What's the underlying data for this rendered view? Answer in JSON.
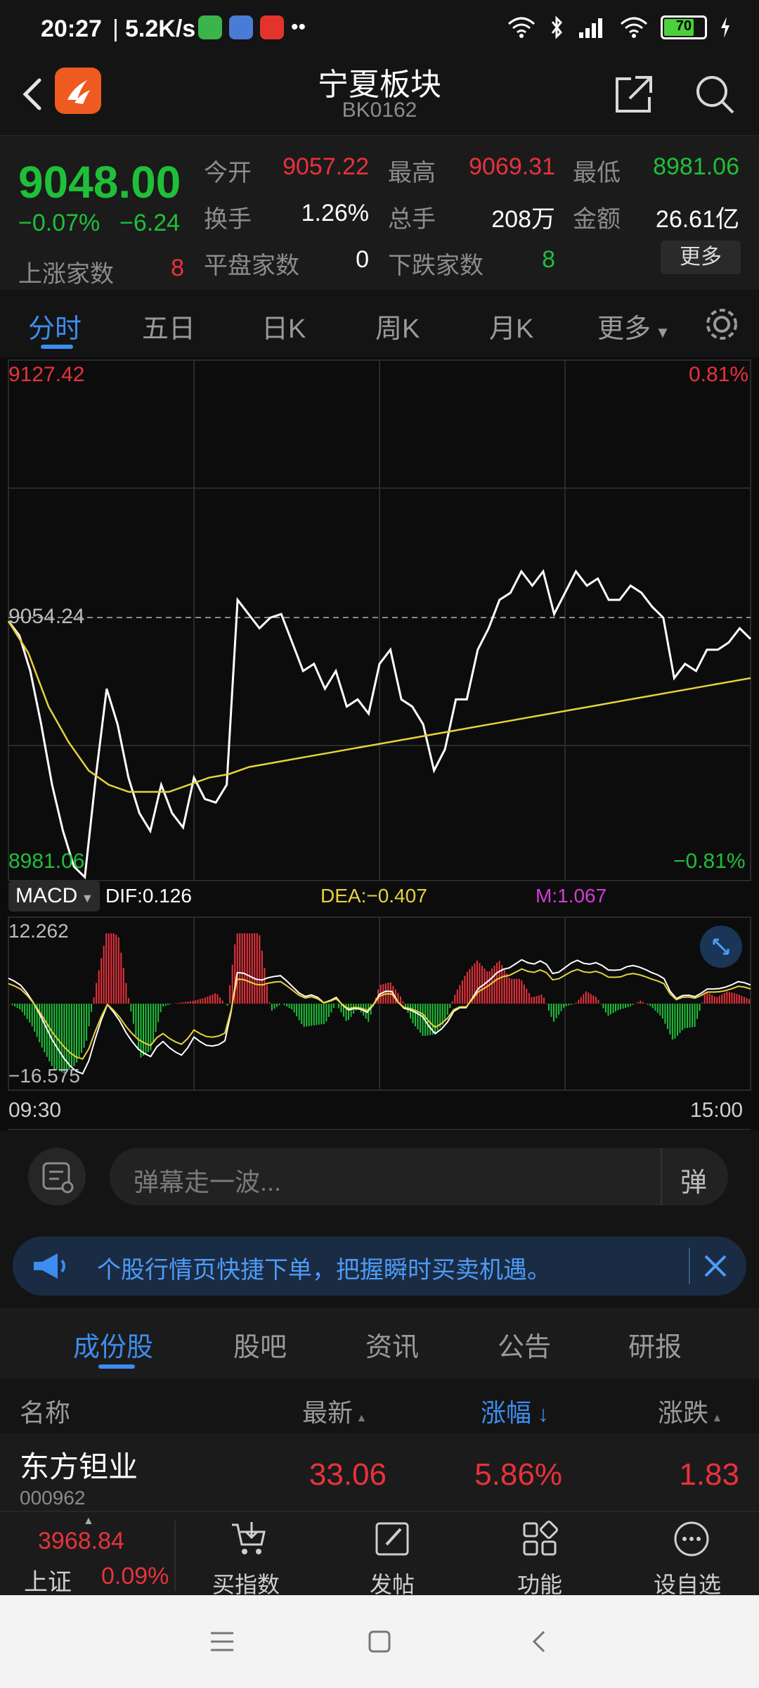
{
  "status_bar": {
    "time": "20:27",
    "separator": "|",
    "speed": "5.2K/s",
    "more_dots": "••",
    "battery": "70"
  },
  "header": {
    "title": "宁夏板块",
    "code": "BK0162",
    "logo_color": "#ee5a1f"
  },
  "quote": {
    "price": "9048.00",
    "change_pct": "−0.07%",
    "change": "−6.24",
    "open_label": "今开",
    "open": "9057.22",
    "high_label": "最高",
    "high": "9069.31",
    "low_label": "最低",
    "low": "8981.06",
    "turnover_label": "换手",
    "turnover": "1.26%",
    "volume_label": "总手",
    "volume": "208万",
    "amount_label": "金额",
    "amount": "26.61亿",
    "up_label": "上涨家数",
    "up_count": "8",
    "flat_label": "平盘家数",
    "flat_count": "0",
    "down_label": "下跌家数",
    "down_count": "8",
    "more_label": "更多"
  },
  "chart_tabs": [
    "分时",
    "五日",
    "日K",
    "周K",
    "月K",
    "更多"
  ],
  "chart_data": {
    "type": "line",
    "price_top": "9127.42",
    "price_mid": "9054.24",
    "price_bottom": "8981.06",
    "pct_top": "0.81%",
    "pct_bottom": "−0.81%",
    "time_start": "09:30",
    "time_end": "15:00",
    "ylim": [
      8981.06,
      9127.42
    ],
    "series": [
      {
        "name": "price",
        "color": "#ffffff",
        "values": [
          9054,
          9050,
          9040,
          9025,
          9008,
          8995,
          8985,
          8982,
          9010,
          9035,
          9025,
          9010,
          9000,
          8995,
          9008,
          9000,
          8996,
          9010,
          9004,
          9003,
          9008,
          9060,
          9056,
          9052,
          9055,
          9056,
          9048,
          9040,
          9042,
          9035,
          9040,
          9030,
          9032,
          9028,
          9042,
          9046,
          9032,
          9030,
          9025,
          9012,
          9018,
          9032,
          9032,
          9046,
          9052,
          9060,
          9062,
          9068,
          9064,
          9068,
          9056,
          9062,
          9068,
          9064,
          9066,
          9060,
          9060,
          9064,
          9062,
          9058,
          9055,
          9038,
          9042,
          9040,
          9046,
          9046,
          9048,
          9052,
          9049
        ]
      },
      {
        "name": "avg",
        "color": "#e6d23c",
        "values": [
          9054,
          9045,
          9030,
          9020,
          9012,
          9008,
          9006,
          9006,
          9006,
          9008,
          9010,
          9011,
          9013,
          9014,
          9015,
          9016,
          9017,
          9018,
          9019,
          9020,
          9021,
          9022,
          9023,
          9024,
          9025,
          9026,
          9027,
          9028,
          9029,
          9030,
          9031,
          9032,
          9033,
          9034,
          9035,
          9036,
          9037,
          9038
        ]
      }
    ]
  },
  "macd": {
    "selector": "MACD",
    "dif": "DIF:0.126",
    "dea": "DEA:−0.407",
    "m": "M:1.067",
    "top": "12.262",
    "bottom": "−16.575"
  },
  "barrage": {
    "placeholder": "弹幕走一波...",
    "send_label": "弹"
  },
  "notice": {
    "text": "个股行情页快捷下单，把握瞬时买卖机遇。"
  },
  "list_tabs": [
    "成份股",
    "股吧",
    "资讯",
    "公告",
    "研报"
  ],
  "columns": {
    "name": "名称",
    "latest": "最新",
    "pct": "涨幅",
    "change": "涨跌"
  },
  "rows": [
    {
      "name": "东方钽业",
      "code": "000962",
      "latest": "33.06",
      "pct": "5.86%",
      "change": "1.83"
    }
  ],
  "bottom_bar": {
    "index_value": "3968.84",
    "index_name": "上证",
    "index_pct": "0.09%",
    "buy_index": "买指数",
    "post": "发帖",
    "functions": "功能",
    "watchlist": "设自选"
  }
}
